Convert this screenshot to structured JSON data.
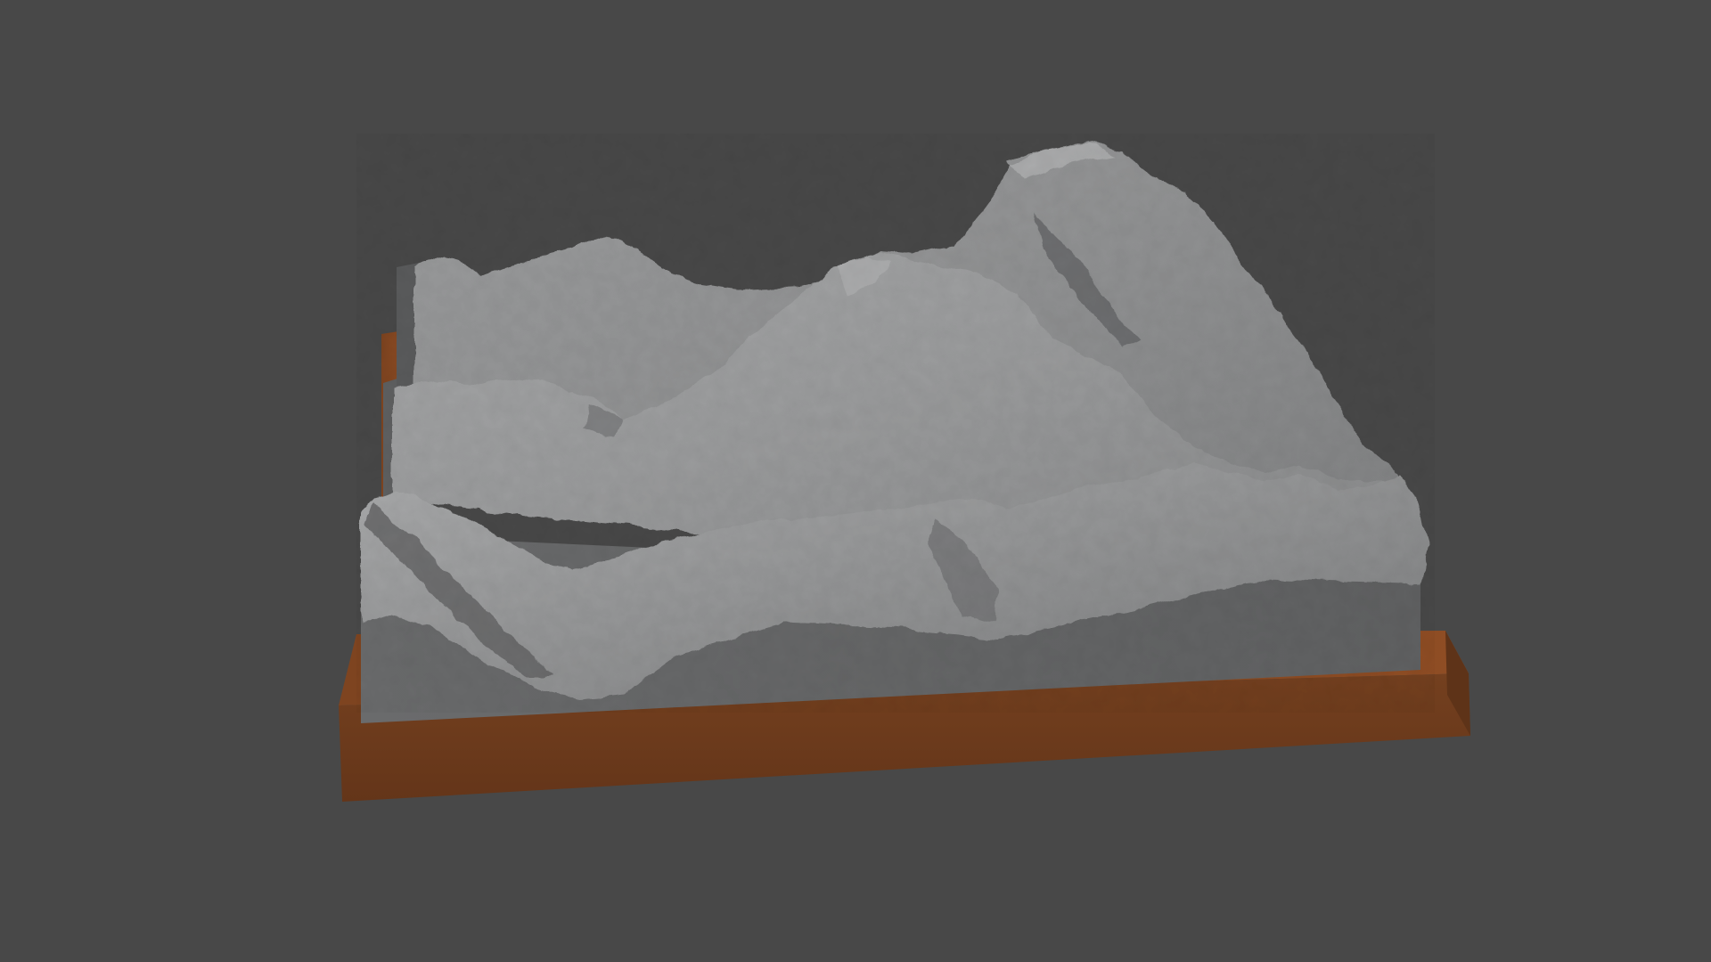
{
  "scene": {
    "kind": "3d-viewport-render",
    "subject": "terrain-relief-model",
    "colors": {
      "background": "#484848",
      "base_wood_top": "#8a4a22",
      "base_wood_front": "#6b3a1c",
      "base_wood_side": "#5e3318",
      "block_front": "#656667",
      "block_side": "#5b5c5d",
      "terrain_light": "#a6a7a8",
      "terrain_mid": "#8c8d8e",
      "terrain_dark": "#5e5f61"
    },
    "objects": [
      {
        "name": "wooden-base",
        "material": "wood"
      },
      {
        "name": "terrain-block",
        "material": "clay-grey"
      },
      {
        "name": "mountain-surface",
        "material": "clay-grey"
      }
    ]
  }
}
